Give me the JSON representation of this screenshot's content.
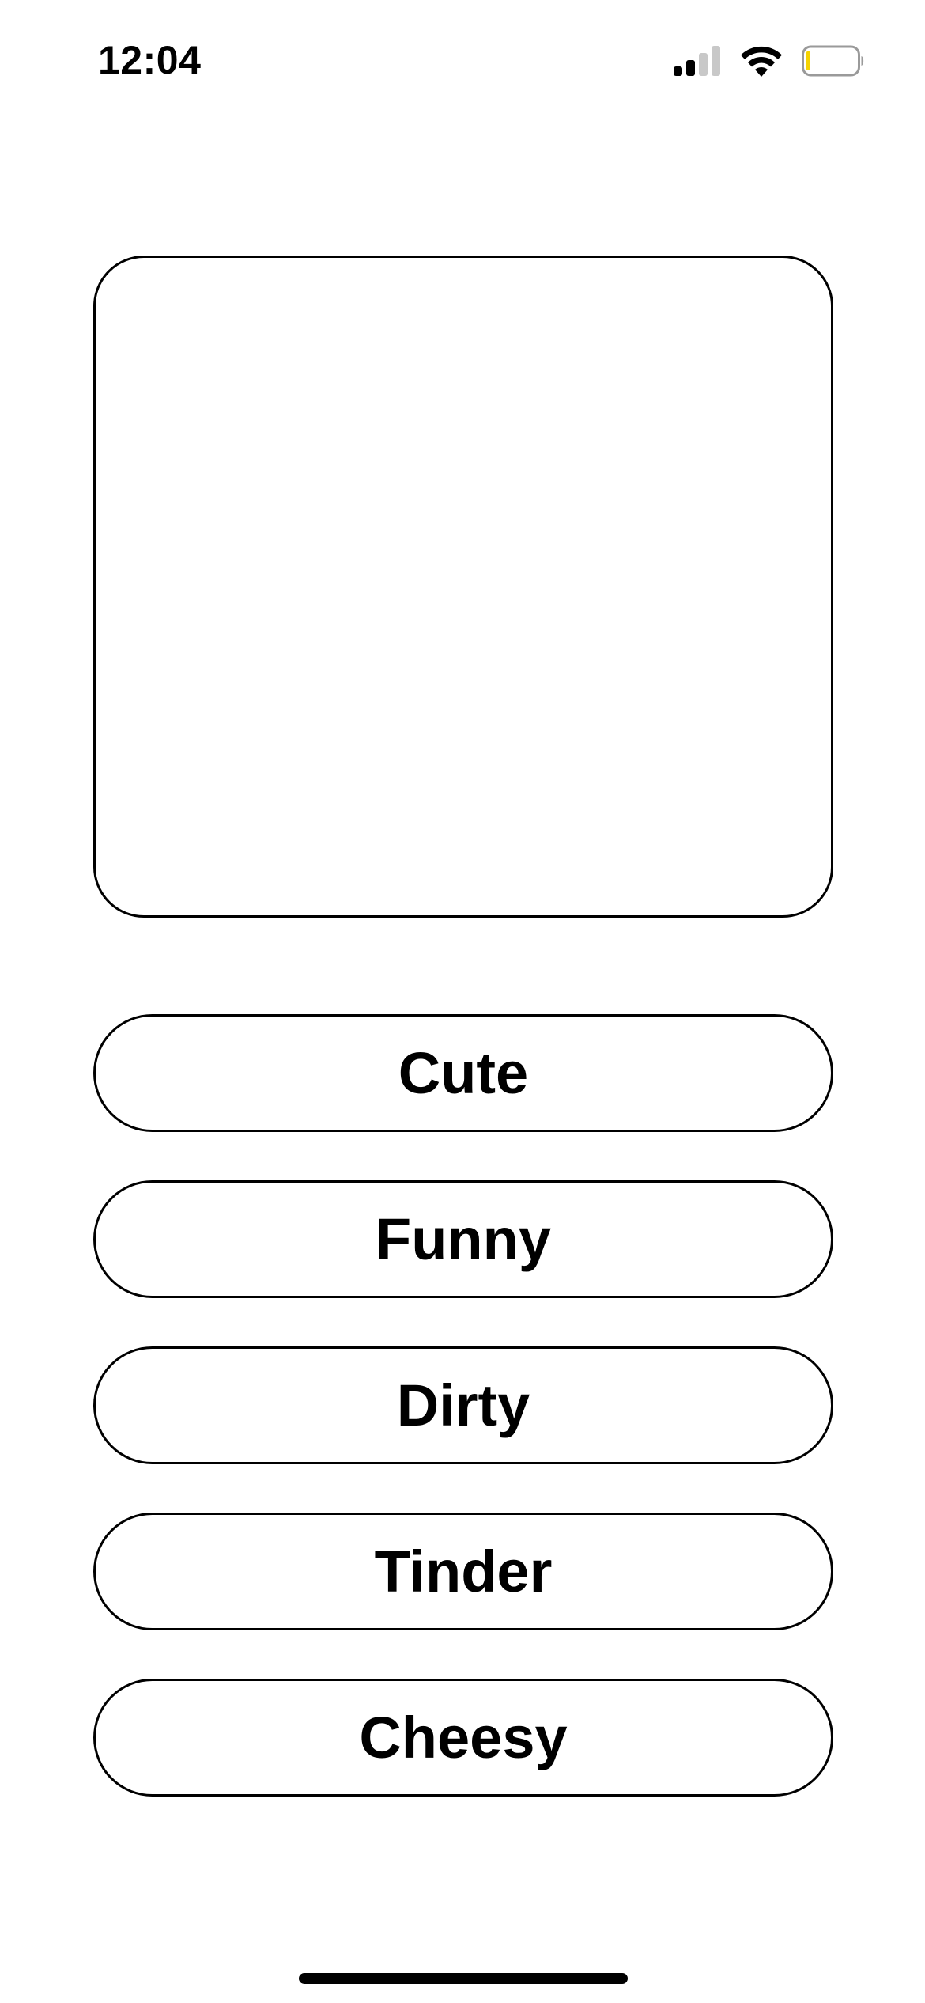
{
  "status_bar": {
    "time": "12:04",
    "icons": [
      "cellular-signal-icon",
      "wifi-icon",
      "battery-icon"
    ],
    "signal_bars_active": 2,
    "signal_bars_total": 4,
    "battery_level": 0.08,
    "battery_color": "#f5d300"
  },
  "main": {
    "card_content": "",
    "options": [
      {
        "label": "Cute"
      },
      {
        "label": "Funny"
      },
      {
        "label": "Dirty"
      },
      {
        "label": "Tinder"
      },
      {
        "label": "Cheesy"
      }
    ]
  },
  "colors": {
    "background": "#ffffff",
    "border": "#000000",
    "text": "#000000"
  }
}
